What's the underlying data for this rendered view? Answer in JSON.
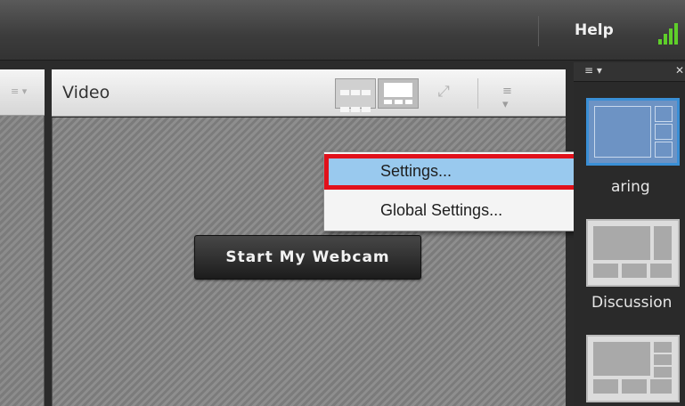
{
  "topbar": {
    "help_label": "Help"
  },
  "left_pod": {
    "menu_glyph": "≡ ▾"
  },
  "video_pod": {
    "title": "Video",
    "start_webcam_label": "Start My Webcam",
    "menu_glyph": "≡ ▾"
  },
  "context_menu": {
    "items": [
      {
        "label": "Settings...",
        "highlighted": true
      },
      {
        "label": "Global Settings...",
        "highlighted": false
      }
    ],
    "highlight_color": "#99c9ee",
    "outline_color": "#e1111b"
  },
  "layouts_panel": {
    "menu_glyph": "≡ ▾",
    "close_glyph": "✕",
    "layouts": [
      {
        "label": "aring",
        "selected": true
      },
      {
        "label": "Discussion",
        "selected": false
      },
      {
        "label": "",
        "selected": false
      }
    ]
  },
  "colors": {
    "signal": "#5fcf2a",
    "selection_border": "#3a8fd6"
  }
}
